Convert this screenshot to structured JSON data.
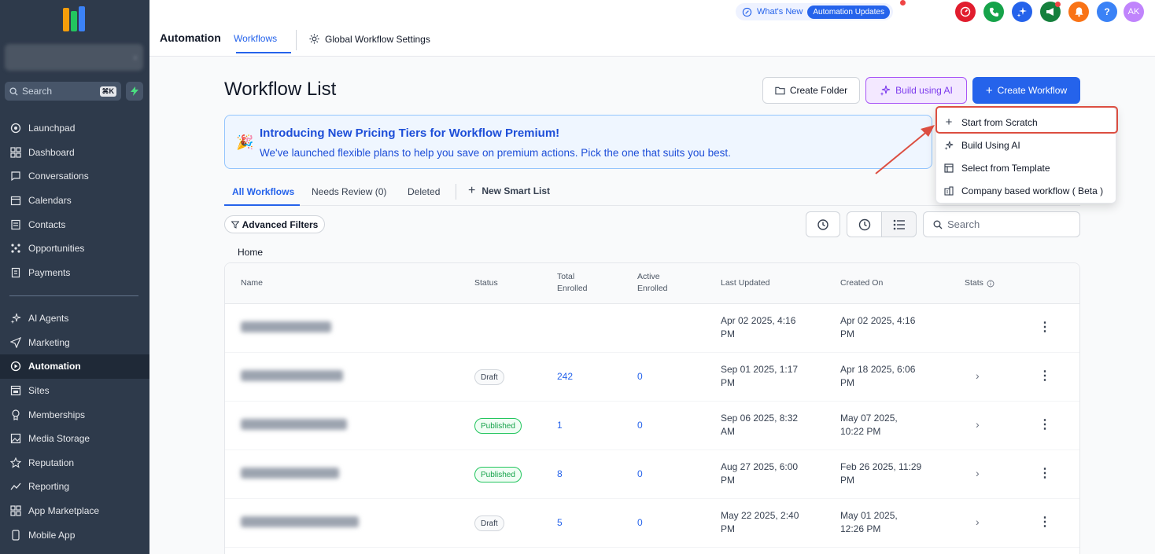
{
  "sidebar": {
    "search_placeholder": "Search",
    "search_shortcut": "⌘K",
    "items_top": [
      {
        "label": "Launchpad",
        "icon": "launchpad-icon"
      },
      {
        "label": "Dashboard",
        "icon": "dashboard-icon"
      },
      {
        "label": "Conversations",
        "icon": "chat-icon"
      },
      {
        "label": "Calendars",
        "icon": "calendar-icon"
      },
      {
        "label": "Contacts",
        "icon": "contacts-icon"
      },
      {
        "label": "Opportunities",
        "icon": "opportunities-icon"
      },
      {
        "label": "Payments",
        "icon": "payments-icon"
      }
    ],
    "items_bottom": [
      {
        "label": "AI Agents",
        "icon": "sparkle-icon"
      },
      {
        "label": "Marketing",
        "icon": "send-icon"
      },
      {
        "label": "Automation",
        "icon": "automation-icon",
        "active": true
      },
      {
        "label": "Sites",
        "icon": "sites-icon"
      },
      {
        "label": "Memberships",
        "icon": "memberships-icon"
      },
      {
        "label": "Media Storage",
        "icon": "media-icon"
      },
      {
        "label": "Reputation",
        "icon": "star-icon"
      },
      {
        "label": "Reporting",
        "icon": "reporting-icon"
      },
      {
        "label": "App Marketplace",
        "icon": "marketplace-icon"
      },
      {
        "label": "Mobile App",
        "icon": "mobile-icon"
      }
    ]
  },
  "topbar": {
    "section": "Automation",
    "tab_workflows": "Workflows",
    "tab_global": "Global Workflow Settings",
    "whats_new": "What's New",
    "automation_updates": "Automation Updates",
    "avatar_initials": "AK",
    "help_glyph": "?",
    "colors": {
      "red": "#e11d2e",
      "green": "#16a34a",
      "blue": "#2563eb",
      "teal": "#15803d",
      "orange": "#f97316",
      "lightblue": "#3b82f6",
      "avatar": "#c084fc"
    }
  },
  "main": {
    "title": "Workflow List",
    "create_folder": "Create Folder",
    "build_using_ai": "Build using AI",
    "create_workflow": "Create Workflow",
    "banner": {
      "title": "Introducing New Pricing Tiers for Workflow Premium!",
      "text": "We've launched flexible plans to help you save on premium actions. Pick the one that suits you best."
    },
    "tabs": {
      "all": "All Workflows",
      "needs_review": "Needs Review (0)",
      "deleted": "Deleted",
      "new_smart_list": "New Smart List"
    },
    "advanced_filters": "Advanced Filters",
    "search_placeholder": "Search",
    "breadcrumb_home": "Home"
  },
  "table": {
    "headers": {
      "name": "Name",
      "status": "Status",
      "total_enrolled_1": "Total",
      "total_enrolled_2": "Enrolled",
      "active_enrolled_1": "Active",
      "active_enrolled_2": "Enrolled",
      "last_updated": "Last Updated",
      "created_on": "Created On",
      "stats": "Stats"
    },
    "rows": [
      {
        "status": "",
        "total": "",
        "active": "",
        "updated_1": "Apr 02 2025, 4:16",
        "updated_2": "PM",
        "created_1": "Apr 02 2025, 4:16",
        "created_2": "PM"
      },
      {
        "status": "Draft",
        "total": "242",
        "active": "0",
        "updated_1": "Sep 01 2025, 1:17",
        "updated_2": "PM",
        "created_1": "Apr 18 2025, 6:06",
        "created_2": "PM"
      },
      {
        "status": "Published",
        "total": "1",
        "active": "0",
        "updated_1": "Sep 06 2025, 8:32",
        "updated_2": "AM",
        "created_1": "May 07 2025,",
        "created_2": "10:22 PM"
      },
      {
        "status": "Published",
        "total": "8",
        "active": "0",
        "updated_1": "Aug 27 2025, 6:00",
        "updated_2": "PM",
        "created_1": "Feb 26 2025, 11:29",
        "created_2": "PM"
      },
      {
        "status": "Draft",
        "total": "5",
        "active": "0",
        "updated_1": "May 22 2025, 2:40",
        "updated_2": "PM",
        "created_1": "May 01 2025,",
        "created_2": "12:26 PM"
      }
    ]
  },
  "dropdown": {
    "items": [
      {
        "label": "Start from Scratch",
        "icon": "plus-icon"
      },
      {
        "label": "Build Using AI",
        "icon": "sparkle-icon"
      },
      {
        "label": "Select from Template",
        "icon": "template-icon"
      },
      {
        "label": "Company based workflow ( Beta )",
        "icon": "building-icon"
      }
    ],
    "highlight_color": "#dc4e41"
  }
}
